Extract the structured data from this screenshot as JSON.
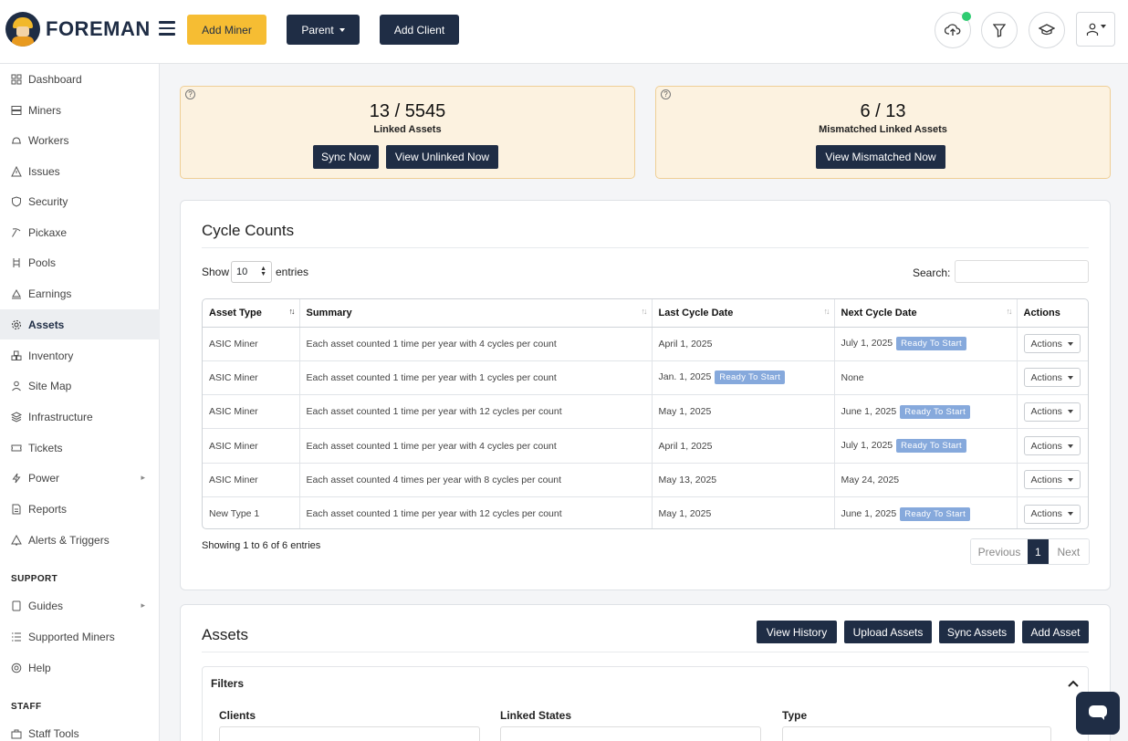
{
  "header": {
    "brand": "FOREMAN",
    "add_miner": "Add Miner",
    "parent": "Parent",
    "add_client": "Add Client"
  },
  "sidebar": {
    "items": [
      {
        "label": "Dashboard",
        "icon": "dashboard-icon"
      },
      {
        "label": "Miners",
        "icon": "server-icon"
      },
      {
        "label": "Workers",
        "icon": "hard-hat-icon"
      },
      {
        "label": "Issues",
        "icon": "warning-icon"
      },
      {
        "label": "Security",
        "icon": "shield-icon"
      },
      {
        "label": "Pickaxe",
        "icon": "pickaxe-icon"
      },
      {
        "label": "Pools",
        "icon": "pools-icon"
      },
      {
        "label": "Earnings",
        "icon": "earnings-icon"
      },
      {
        "label": "Assets",
        "icon": "gear-icon"
      },
      {
        "label": "Inventory",
        "icon": "boxes-icon"
      },
      {
        "label": "Site Map",
        "icon": "sitemap-icon"
      },
      {
        "label": "Infrastructure",
        "icon": "layers-icon"
      },
      {
        "label": "Tickets",
        "icon": "ticket-icon"
      },
      {
        "label": "Power",
        "icon": "bolt-icon"
      },
      {
        "label": "Reports",
        "icon": "report-icon"
      },
      {
        "label": "Alerts & Triggers",
        "icon": "bell-icon"
      }
    ],
    "support_heading": "SUPPORT",
    "support_items": [
      {
        "label": "Guides",
        "icon": "book-icon"
      },
      {
        "label": "Supported Miners",
        "icon": "list-icon"
      },
      {
        "label": "Help",
        "icon": "lifebuoy-icon"
      }
    ],
    "staff_heading": "STAFF",
    "staff_items": [
      {
        "label": "Staff Tools",
        "icon": "toolbox-icon"
      }
    ]
  },
  "linked": {
    "value": "13 / 5545",
    "label": "Linked Assets",
    "sync_now": "Sync Now",
    "view_unlinked": "View Unlinked Now"
  },
  "mismatched": {
    "value": "6 / 13",
    "label": "Mismatched Linked Assets",
    "view_mismatched": "View Mismatched Now"
  },
  "cycle_counts": {
    "title": "Cycle Counts",
    "show": "Show",
    "entries_value": "10",
    "entries": "entries",
    "search": "Search:",
    "columns": [
      "Asset Type",
      "Summary",
      "Last Cycle Date",
      "Next Cycle Date",
      "Actions"
    ],
    "rows": [
      {
        "type": "ASIC Miner",
        "summary": "Each asset counted 1 time per year with 4 cycles per count",
        "last": "April 1, 2025",
        "last_badge": "",
        "next": "July 1, 2025",
        "next_badge": "Ready To Start",
        "action": "Actions"
      },
      {
        "type": "ASIC Miner",
        "summary": "Each asset counted 1 time per year with 1 cycles per count",
        "last": "Jan. 1, 2025",
        "last_badge": "Ready To Start",
        "next": "None",
        "next_badge": "",
        "action": "Actions"
      },
      {
        "type": "ASIC Miner",
        "summary": "Each asset counted 1 time per year with 12 cycles per count",
        "last": "May 1, 2025",
        "last_badge": "",
        "next": "June 1, 2025",
        "next_badge": "Ready To Start",
        "action": "Actions"
      },
      {
        "type": "ASIC Miner",
        "summary": "Each asset counted 1 time per year with 4 cycles per count",
        "last": "April 1, 2025",
        "last_badge": "",
        "next": "July 1, 2025",
        "next_badge": "Ready To Start",
        "action": "Actions"
      },
      {
        "type": "ASIC Miner",
        "summary": "Each asset counted 4 times per year with 8 cycles per count",
        "last": "May 13, 2025",
        "last_badge": "",
        "next": "May 24, 2025",
        "next_badge": "",
        "action": "Actions"
      },
      {
        "type": "New Type 1",
        "summary": "Each asset counted 1 time per year with 12 cycles per count",
        "last": "May 1, 2025",
        "last_badge": "",
        "next": "June 1, 2025",
        "next_badge": "Ready To Start",
        "action": "Actions"
      }
    ],
    "showing": "Showing 1 to 6 of 6 entries",
    "previous": "Previous",
    "page": "1",
    "next": "Next"
  },
  "assets": {
    "title": "Assets",
    "view_history": "View History",
    "upload_assets": "Upload Assets",
    "sync_assets": "Sync Assets",
    "add_asset": "Add Asset",
    "filters": "Filters",
    "clients": "Clients",
    "linked_states": "Linked States",
    "type": "Type"
  },
  "colors": {
    "navy": "#1f2d45",
    "yellow": "#f6bd33",
    "badge": "#86a9dc",
    "card_bg": "#fcf2e0"
  }
}
